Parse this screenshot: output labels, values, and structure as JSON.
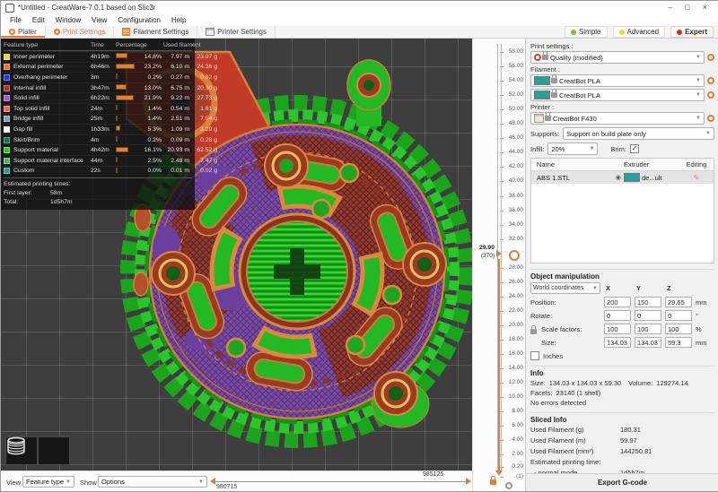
{
  "window": {
    "title": "*Untitled - CreatWare-7.0.1 based on Slic3r",
    "controls": {
      "minimize": "–",
      "maximize": "□",
      "close": "×"
    }
  },
  "menu": {
    "items": [
      "File",
      "Edit",
      "Window",
      "View",
      "Configuration",
      "Help"
    ]
  },
  "tabs": [
    {
      "label": "Plater"
    },
    {
      "label": "Print Settings"
    },
    {
      "label": "Filament Settings"
    },
    {
      "label": "Printer Settings"
    }
  ],
  "modes": [
    {
      "label": "Simple",
      "color": "#7ac142"
    },
    {
      "label": "Advanced",
      "color": "#f0d330"
    },
    {
      "label": "Expert",
      "color": "#cc3322"
    }
  ],
  "legend": {
    "headers": {
      "feature": "Feature type",
      "time": "Time",
      "percentage": "Percentage",
      "used": "Used filament"
    },
    "rows": [
      {
        "label": "Inner perimeter",
        "color": "#f2d53d",
        "time": "4h19m",
        "pct": 14.8,
        "pct_label": "14.8%",
        "m": "7.97 m",
        "g": "23.97 g"
      },
      {
        "label": "External perimeter",
        "color": "#e6742b",
        "time": "6h46m",
        "pct": 23.2,
        "pct_label": "23.2%",
        "m": "6.10 m",
        "g": "24.36 g"
      },
      {
        "label": "Overhang perimeter",
        "color": "#2638e0",
        "time": "3m",
        "pct": 0.2,
        "pct_label": "0.2%",
        "m": "0.27 m",
        "g": "0.82 g"
      },
      {
        "label": "Internal infill",
        "color": "#a83325",
        "time": "3h47m",
        "pct": 13.0,
        "pct_label": "13.0%",
        "m": "6.75 m",
        "g": "20.30 g"
      },
      {
        "label": "Solid infill",
        "color": "#9a5bc4",
        "time": "6h22m",
        "pct": 21.9,
        "pct_label": "21.9%",
        "m": "9.22 m",
        "g": "27.73 g"
      },
      {
        "label": "Top solid infill",
        "color": "#e8694e",
        "time": "24m",
        "pct": 1.4,
        "pct_label": "1.4%",
        "m": "0.54 m",
        "g": "1.61 g"
      },
      {
        "label": "Bridge infill",
        "color": "#7fa5b5",
        "time": "25m",
        "pct": 1.4,
        "pct_label": "1.4%",
        "m": "2.51 m",
        "g": "7.54 g"
      },
      {
        "label": "Gap fill",
        "color": "#ffffff",
        "time": "1h33m",
        "pct": 5.3,
        "pct_label": "5.3%",
        "m": "1.09 m",
        "g": "3.29 g"
      },
      {
        "label": "Skirt/Brim",
        "color": "#0f6e55",
        "time": "4m",
        "pct": 0.2,
        "pct_label": "0.2%",
        "m": "0.09 m",
        "g": "0.28 g"
      },
      {
        "label": "Support material",
        "color": "#2cc52c",
        "time": "4h42m",
        "pct": 16.1,
        "pct_label": "16.1%",
        "m": "20.93 m",
        "g": "62.52 g"
      },
      {
        "label": "Support material interface",
        "color": "#41b960",
        "time": "44m",
        "pct": 2.5,
        "pct_label": "2.5%",
        "m": "2.48 m",
        "g": "7.47 g"
      },
      {
        "label": "Custom",
        "color": "#2a9d8f",
        "time": "22s",
        "pct": 0.0,
        "pct_label": "0.0%",
        "m": "0.01 m",
        "g": "0.02 g"
      }
    ],
    "estimated": {
      "title": "Estimated printing times:",
      "first_layer_label": "First layer:",
      "first_layer": "58m",
      "total_label": "Total:",
      "total": "1d5h7m"
    }
  },
  "layer_slider": {
    "ticks_above": [
      "58.00",
      "56.00",
      "54.00",
      "52.00",
      "50.00",
      "48.00",
      "46.00",
      "44.00",
      "42.00",
      "40.00",
      "38.00",
      "36.00",
      "34.00",
      "32.00"
    ],
    "ticks_below": [
      "28.00",
      "26.00",
      "24.00",
      "22.00",
      "20.00",
      "18.00",
      "16.00",
      "14.00",
      "12.00",
      "10.00",
      "8.00",
      "6.00",
      "4.00",
      "2.00"
    ],
    "bottom": "0.20",
    "bottom_layer": "(1)",
    "current": "29.90",
    "current_layer": "(370)"
  },
  "bottom_bar": {
    "view_label": "View",
    "view": "Feature type",
    "show_label": "Show",
    "show": "Options",
    "range_start": "980715",
    "range_end": "985125"
  },
  "right_panel": {
    "print_settings_label": "Print settings :",
    "print_setting": "Quality (modified)",
    "filament_label": "Filament :",
    "filaments": [
      "CreatBot PLA",
      "CreatBot PLA"
    ],
    "printer_label": "Printer :",
    "printer": "CreatBot F430",
    "supports_label": "Supports:",
    "supports": "Support on build plate only",
    "infill_label": "Infill:",
    "infill": "20%",
    "brim_label": "Brim:",
    "brim_check": "✓",
    "table": {
      "headers": [
        "Name",
        "Extruder",
        "Editing"
      ],
      "row": {
        "name": "ABS 1.STL",
        "extruder": "de...ult"
      }
    },
    "object_manipulation": {
      "title": "Object manipulation",
      "coords": "World coordinates",
      "axes": [
        "X",
        "Y",
        "Z"
      ],
      "position_label": "Position:",
      "position": [
        "200",
        "150",
        "29.65"
      ],
      "position_unit": "mm",
      "rotate_label": "Rotate:",
      "rotate": [
        "0",
        "0",
        "0"
      ],
      "rotate_unit": "°",
      "scale_label": "Scale factors:",
      "scale": [
        "100",
        "100",
        "100"
      ],
      "scale_unit": "%",
      "size_label": "Size:",
      "size": [
        "134.03",
        "134.03",
        "59.3"
      ],
      "size_unit": "mm",
      "inches_label": "Inches"
    },
    "info": {
      "title": "Info",
      "size_label": "Size:",
      "size": "134.03 x 134.03 x 59.30",
      "volume_label": "Volume:",
      "volume": "129274.14",
      "facets_label": "Facets:",
      "facets": "23140 (1 shell)",
      "status": "No errors detected"
    },
    "sliced_info": {
      "title": "Sliced Info",
      "rows": [
        [
          "Used Filament (g)",
          "180.31"
        ],
        [
          "Used Filament (m)",
          "59.97"
        ],
        [
          "Used Filament (mm³)",
          "144250.81"
        ]
      ],
      "time_label": "Estimated printing time:",
      "mode_label": "- normal mode",
      "time": "1d5h7m"
    },
    "export_button": "Export G-code"
  }
}
